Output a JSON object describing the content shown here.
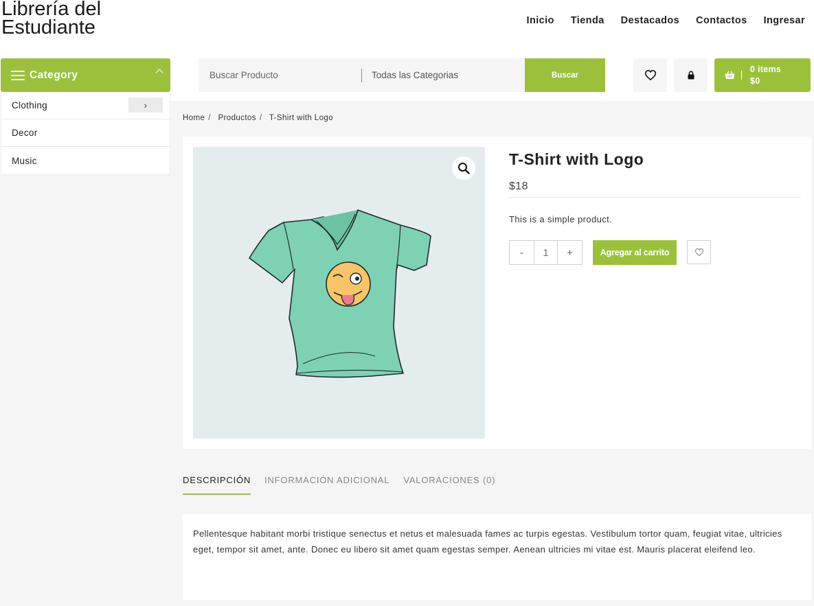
{
  "site": {
    "title_line1": "Librería del",
    "title_line2": "Estudiante"
  },
  "nav": [
    "Inicio",
    "Tienda",
    "Destacados",
    "Contactos",
    "Ingresar"
  ],
  "category": {
    "title": "Category",
    "items": [
      {
        "label": "Clothing",
        "submenu_icon": "chevron-right-icon",
        "submenu_glyph": "›"
      },
      {
        "label": "Decor"
      },
      {
        "label": "Music"
      }
    ]
  },
  "search": {
    "placeholder": "Buscar Producto",
    "category_value": "Todas las Categorias",
    "button_label": "Buscar"
  },
  "header_icons": [
    "heart-icon",
    "lock-icon"
  ],
  "cart": {
    "items_label": "0 items",
    "total": "$0"
  },
  "breadcrumb": [
    "Home",
    "Productos",
    "T-Shirt with Logo"
  ],
  "product": {
    "title": "T-Shirt with Logo",
    "price": "$18",
    "short_description": "This is a simple product.",
    "qty_minus": "-",
    "qty_value": "1",
    "qty_plus": "+",
    "add_to_cart_label": "Agregar al carrito"
  },
  "tabs": [
    {
      "label": "DESCRIPCIÓN",
      "active": true
    },
    {
      "label": "INFORMACIÓN ADICIONAL",
      "active": false
    },
    {
      "label": "VALORACIONES (0)",
      "active": false
    }
  ],
  "description": "Pellentesque habitant morbi tristique senectus et netus et malesuada fames ac turpis egestas. Vestibulum tortor quam, feugiat vitae, ultricies eget, tempor sit amet, ante. Donec eu libero sit amet quam egestas semper. Aenean ultricies mi vitae est. Mauris placerat eleifend leo.",
  "colors": {
    "accent": "#9bc13c",
    "panel_bg": "#f5f5f5",
    "image_bg": "#e4ecee",
    "shirt": "#7fd1b4"
  }
}
